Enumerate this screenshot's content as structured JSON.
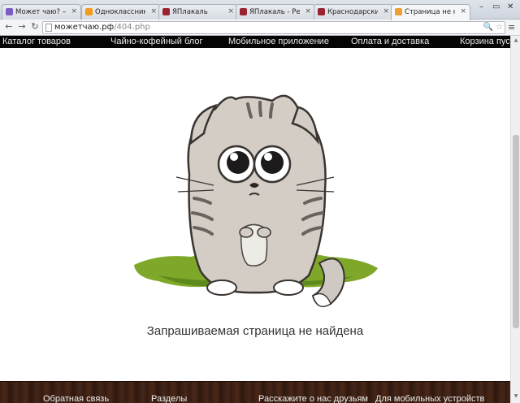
{
  "tabs": [
    {
      "title": "Может чаю? — св",
      "favicon_color": "#7b5cc7",
      "active": false
    },
    {
      "title": "Одноклассники",
      "favicon_color": "#f29a1c",
      "active": false
    },
    {
      "title": "ЯПлакаль",
      "favicon_color": "#9b2230",
      "active": false
    },
    {
      "title": "ЯПлакаль - Резуль",
      "favicon_color": "#9b2230",
      "active": false
    },
    {
      "title": "Краснодарский сл",
      "favicon_color": "#9b2230",
      "active": false
    },
    {
      "title": "Страница не найд",
      "favicon_color": "#f0a030",
      "active": true
    }
  ],
  "window_controls": {
    "minimize": "–",
    "restore": "▭",
    "close": "✕"
  },
  "address_bar": {
    "domain": "можетчаю.рф",
    "path": "/404.php"
  },
  "nav": [
    "Каталог товаров",
    "Чайно-кофейный блог",
    "Мобильное приложение",
    "Оплата и доставка",
    "Корзина пуста"
  ],
  "message": "Запрашиваемая страница не найдена",
  "footer": [
    "Обратная связь",
    "Разделы",
    "Расскажите о нас друзьям",
    "Для мобильных устройств"
  ],
  "icons": {
    "back": "←",
    "forward": "→",
    "reload": "↻",
    "search": "🔍",
    "star": "☆",
    "menu": "≡",
    "tab_close": "×",
    "scroll_up": "▲",
    "scroll_down": "▼"
  }
}
